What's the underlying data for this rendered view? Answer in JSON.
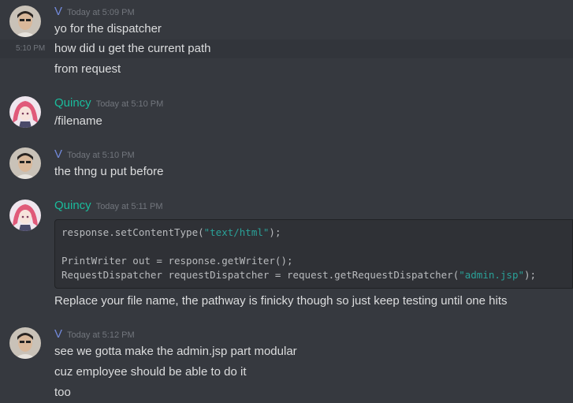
{
  "messages": [
    {
      "author": "V",
      "author_color": "#7289da",
      "avatar": "user-avatar-v",
      "timestamp": "Today at 5:09 PM",
      "lines": [
        "yo for the dispatcher"
      ]
    },
    {
      "continuation": true,
      "inline_timestamp": "5:10 PM",
      "lines": [
        "how did u get the current path",
        "from request"
      ]
    },
    {
      "author": "Quincy",
      "author_color": "#1abc9c",
      "avatar": "user-avatar-quincy",
      "timestamp": "Today at 5:10 PM",
      "lines": [
        "/filename"
      ]
    },
    {
      "author": "V",
      "author_color": "#7289da",
      "avatar": "user-avatar-v",
      "timestamp": "Today at 5:10 PM",
      "lines": [
        "the thng u put before"
      ]
    },
    {
      "author": "Quincy",
      "author_color": "#1abc9c",
      "avatar": "user-avatar-quincy",
      "timestamp": "Today at 5:11 PM",
      "code": {
        "line1_a": "response.setContentType(",
        "line1_str": "\"text/html\"",
        "line1_b": ");",
        "line2": "",
        "line3": "PrintWriter out = response.getWriter();",
        "line4_a": "RequestDispatcher requestDispatcher = request.getRequestDispatcher(",
        "line4_str": "\"admin.jsp\"",
        "line4_b": ");"
      },
      "lines": [
        "Replace your file name, the pathway is finicky though so just keep testing until one hits"
      ]
    },
    {
      "author": "V",
      "author_color": "#7289da",
      "avatar": "user-avatar-v",
      "timestamp": "Today at 5:12 PM",
      "lines": [
        "see we gotta make the admin.jsp part modular",
        "cuz employee should be able to do it",
        "too"
      ]
    }
  ]
}
